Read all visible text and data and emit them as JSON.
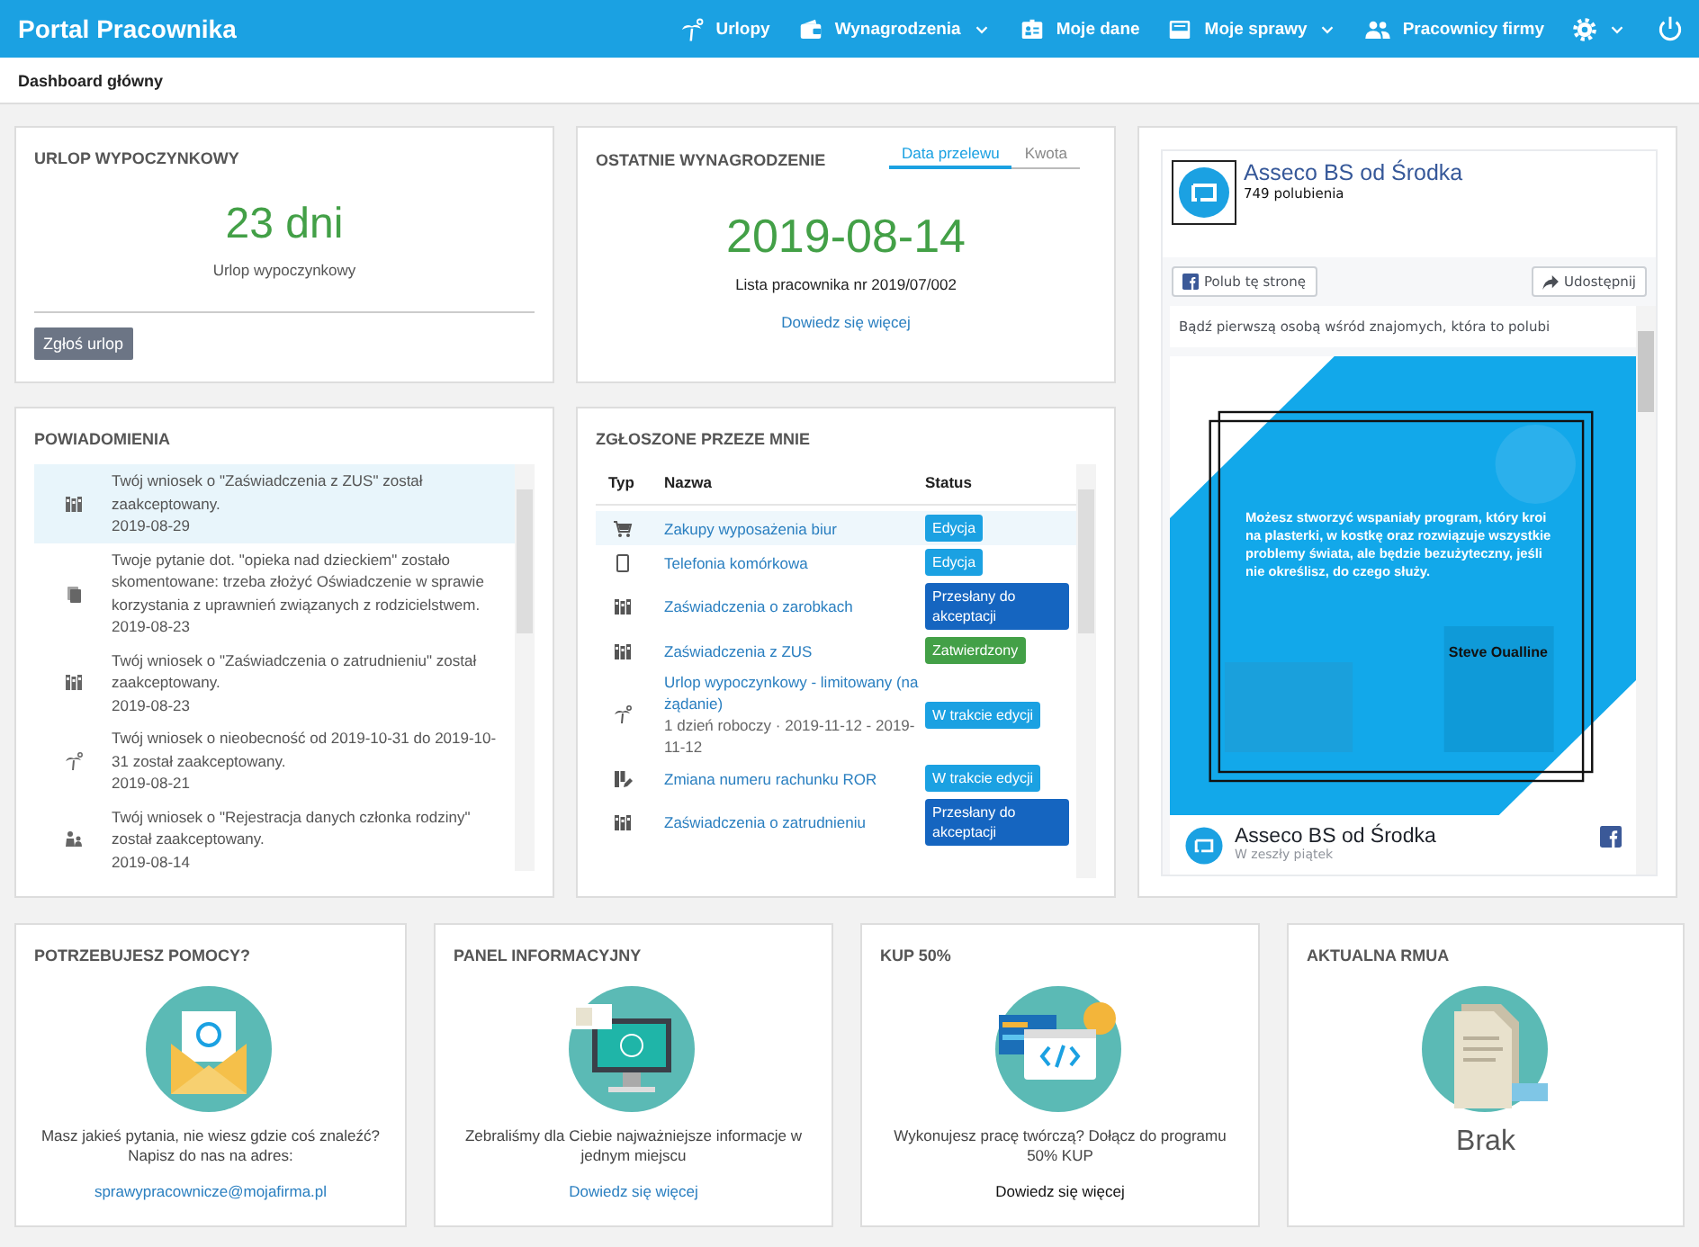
{
  "topbar": {
    "brand": "Portal Pracownika",
    "nav": [
      {
        "label": "Urlopy",
        "kind": "palm",
        "dropdown": false
      },
      {
        "label": "Wynagrodzenia",
        "kind": "wallet",
        "dropdown": true
      },
      {
        "label": "Moje dane",
        "kind": "idcard",
        "dropdown": false
      },
      {
        "label": "Moje sprawy",
        "kind": "inbox",
        "dropdown": true
      },
      {
        "label": "Pracownicy firmy",
        "kind": "people",
        "dropdown": false
      }
    ]
  },
  "page_title": "Dashboard główny",
  "leave": {
    "title": "URLOP WYPOCZYNKOWY",
    "value": "23 dni",
    "caption": "Urlop wypoczynkowy",
    "button": "Zgłoś urlop"
  },
  "salary": {
    "title": "OSTATNIE WYNAGRODZENIE",
    "tabs": [
      {
        "label": "Data przelewu",
        "selected": true
      },
      {
        "label": "Kwota",
        "selected": false
      }
    ],
    "value": "2019-08-14",
    "caption": "Lista pracownika nr 2019/07/002",
    "link": "Dowiedz się więcej"
  },
  "notifications": {
    "title": "POWIADOMIENIA",
    "items": [
      {
        "kind": "binders",
        "text": "Twój wniosek o \"Zaświadczenia z ZUS\" został zaakceptowany.",
        "date": "2019-08-29",
        "selected": true
      },
      {
        "kind": "copy",
        "text": "Twoje pytanie dot. \"opieka nad dzieckiem\" zostało skomentowane: trzeba złożyć Oświadczenie w sprawie korzystania z uprawnień związanych z rodzicielstwem.",
        "date": "2019-08-23",
        "selected": false
      },
      {
        "kind": "binders",
        "text": "Twój wniosek o \"Zaświadczenia o zatrudnieniu\" został zaakceptowany.",
        "date": "2019-08-23",
        "selected": false
      },
      {
        "kind": "palm",
        "text": "Twój wniosek o nieobecność od 2019-10-31 do 2019-10-31 został zaakceptowany.",
        "date": "2019-08-21",
        "selected": false
      },
      {
        "kind": "family",
        "text": "Twój wniosek o \"Rejestracja danych członka rodziny\" został zaakceptowany.",
        "date": "2019-08-14",
        "selected": false
      }
    ]
  },
  "requests": {
    "title": "ZGŁOSZONE PRZEZE MNIE",
    "columns": [
      "Typ",
      "Nazwa",
      "Status"
    ],
    "rows": [
      {
        "kind": "cart",
        "name": "Zakupy wyposażenia biur",
        "status": "Edycja",
        "color": "#1ba1e2",
        "selected": true
      },
      {
        "kind": "phone",
        "name": "Telefonia komórkowa",
        "status": "Edycja",
        "color": "#1ba1e2",
        "selected": false
      },
      {
        "kind": "binders",
        "name": "Zaświadczenia o zarobkach",
        "status": "Przesłany do akceptacji",
        "color": "#1565c0",
        "selected": false
      },
      {
        "kind": "binders",
        "name": "Zaświadczenia z ZUS",
        "status": "Zatwierdzony",
        "color": "#43a047",
        "selected": false
      },
      {
        "kind": "palm",
        "name": "Urlop wypoczynkowy - limitowany (na żądanie)",
        "detail": "1 dzień roboczy · 2019-11-12 - 2019-11-12",
        "status": "W trakcie edycji",
        "color": "#1ba1e2",
        "selected": false
      },
      {
        "kind": "edit",
        "name": "Zmiana numeru rachunku ROR",
        "status": "W trakcie edycji",
        "color": "#1ba1e2",
        "selected": false
      },
      {
        "kind": "binders",
        "name": "Zaświadczenia o zatrudnieniu",
        "status": "Przesłany do akceptacji",
        "color": "#1565c0",
        "selected": false
      }
    ]
  },
  "facebook": {
    "page_name": "Asseco BS od Środka",
    "likes": "749 polubienia",
    "like_button": "Polub tę stronę",
    "share_button": "Udostępnij",
    "prompt": "Bądź pierwszą osobą wśród znajomych, która to polubi",
    "post": {
      "kind": "picture",
      "quote": "Możesz stworzyć wspaniały program, który kroi na plasterki, w kostkę oraz rozwiązuje wszystkie problemy świata, ale będzie bezużyteczny, jeśli nie określisz, do czego służy.",
      "author": "Steve Oualline",
      "page_name": "Asseco BS od Środka",
      "time": "W zeszły piątek"
    }
  },
  "info_cards": [
    {
      "kind": "email",
      "title": "POTRZEBUJESZ POMOCY?",
      "text": "Masz jakieś pytania, nie wiesz gdzie coś znaleźć? Napisz do nas na adres:",
      "link": "sprawypracownicze@mojafirma.pl",
      "hovered": false
    },
    {
      "kind": "monitor",
      "title": "PANEL INFORMACYJNY",
      "text": "Zebraliśmy dla Ciebie najważniejsze informacje w jednym miejscu",
      "link": "Dowiedz się więcej",
      "hovered": false
    },
    {
      "kind": "code",
      "title": "KUP 50%",
      "text": "Wykonujesz pracę twórczą? Dołącz do programu 50% KUP",
      "link": "Dowiedz się więcej",
      "hovered": true
    },
    {
      "kind": "document",
      "title": "AKTUALNA RMUA",
      "value": "Brak"
    }
  ]
}
